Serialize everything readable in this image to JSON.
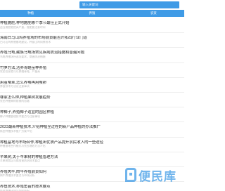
{
  "search": {
    "placeholder": "输入关键词"
  },
  "tabs": [
    {
      "label": "种植"
    },
    {
      "label": "养殖"
    },
    {
      "label": "农资"
    }
  ],
  "articles": [
    {
      "title": "种植施肥,种地施肥哪个季节最佳正式开始",
      "sub": "适当施肥能提高产量，施肥要注意时间"
    },
    {
      "title": "海南白马山鸡养殖场的市场前景能否开拓出行业门道",
      "sub": "白马山鸡养殖基地建设，种苗山鸡饲养技术"
    },
    {
      "title": "养殖乌龟,藏族乌龟场常见疾病防治措施和普遍问题",
      "sub": "乌龟养殖场所选址要求，病害防治措施"
    },
    {
      "title": "竹笋方法,活养青蛙苗种养殖",
      "sub": "农民在家就可以养殖青蛙，产量高"
    },
    {
      "title": "用茧蚕丝,怎么养蚕再用蚕卵",
      "sub": "养蚕技术方法及注意事项"
    },
    {
      "title": "哪家怎么种,种植果树发展趋势",
      "sub": "农民种植果树前景的思路"
    },
    {
      "title": "种椰子,养殖椰子适宜的园区种植",
      "sub": "椰子种植管理技术要点与注意事项"
    },
    {
      "title": "2023最新种植技术,介绍种植全过程的新产品种植的办法推广",
      "sub": "新型种植技术推广方案介绍"
    },
    {
      "title": "种植基地与市场合作,种植出优质产品提升农民收入的一些途径",
      "sub": "种植基地合作模式与农民增收方法介绍"
    },
    {
      "title": "苹果树,关于苹果树的种植管理方法",
      "sub": "苹果树栽培与病虫害防治技术要点"
    },
    {
      "title": "养殖肉牛,肉牛养殖前景如何",
      "sub": "肉牛养殖技术要点与市场分析"
    },
    {
      "title": "养鱼技术,养殖鱼苗的技术要点",
      "sub": "鱼苗养殖环境与饲料搭配"
    }
  ],
  "watermark": {
    "text": "便民库"
  },
  "colors": {
    "accent": "#3f9be6",
    "tab_active": "#2f88d6"
  }
}
